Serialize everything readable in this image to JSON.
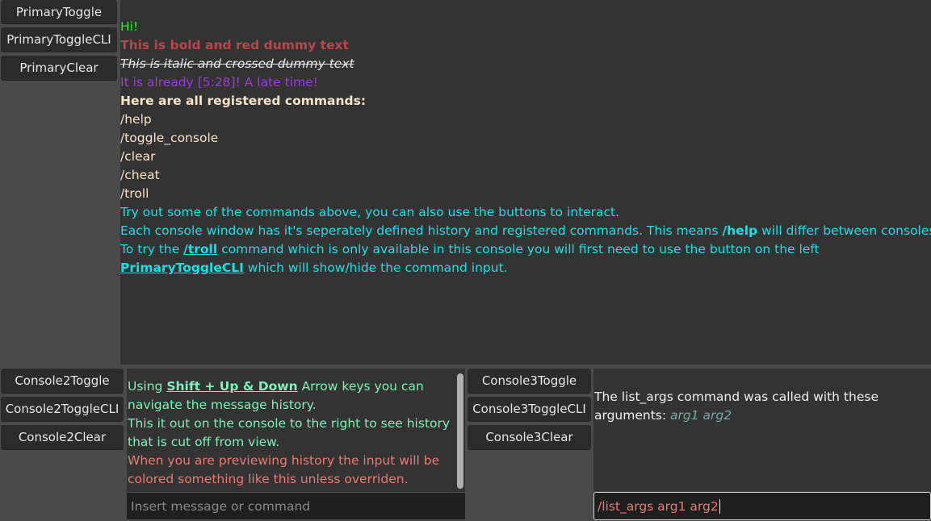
{
  "left_panel": {
    "buttons": [
      "PrimaryToggle",
      "PrimaryToggleCLI",
      "PrimaryClear"
    ]
  },
  "main_console": {
    "lines": {
      "hi": "Hi!",
      "bold_red": "This is bold and red dummy text",
      "italic_crossed": "This is italic and crossed dummy text",
      "late_time": "It is already [5:28]! A late time!",
      "commands_header": "Here are all registered commands:",
      "cmd_help": "/help",
      "cmd_toggle_console": "/toggle_console",
      "cmd_clear": "/clear",
      "cmd_cheat": "/cheat",
      "cmd_troll": "/troll",
      "try_out": "Try out some of the commands above, you can also use the buttons to interact.",
      "each_console_a": "Each console window has it's seperately defined history and registered commands. This means ",
      "each_console_help": "/help",
      "each_console_b": " will differ between consoles.",
      "try_troll_a": "To try the ",
      "try_troll_cmd": "/troll",
      "try_troll_b": " command which is only available in this console you will first need to use the button on the left",
      "cli_link": "PrimaryToggleCLI",
      "cli_rest": " which will show/hide the command input."
    }
  },
  "console2_panel": {
    "buttons": [
      "Console2Toggle",
      "Console2ToggleCLI",
      "Console2Clear"
    ],
    "text": {
      "using": "Using ",
      "keys": "Shift + Up & Down",
      "arrow_rest": " Arrow keys you can",
      "navigate": "navigate the message history.",
      "try_right": "This it out on the console to the right to see history",
      "cut_off": "that is cut off from view.",
      "preview_1": "When you are previewing history the input will be",
      "preview_2": "colored something like this unless overriden."
    },
    "input_placeholder": "Insert message or command"
  },
  "console3_panel": {
    "buttons": [
      "Console3Toggle",
      "Console3ToggleCLI",
      "Console3Clear"
    ],
    "text": {
      "called": "The list_args command was called with these arguments: ",
      "args": "arg1 arg2"
    },
    "input_value": "/list_args arg1 arg2"
  },
  "colors": {
    "background": "#4a4a4a",
    "console_bg": "#333333",
    "button_bg": "#2b2b2b",
    "input_bg": "#1f1f1f",
    "green": "#2ee62e",
    "red": "#b8474a",
    "purple": "#9b3bd8",
    "cream": "#f7e3c7",
    "cyan": "#19e0e6",
    "mint": "#7ef2b8",
    "salmon": "#e87b73",
    "teal": "#79a8a9"
  }
}
